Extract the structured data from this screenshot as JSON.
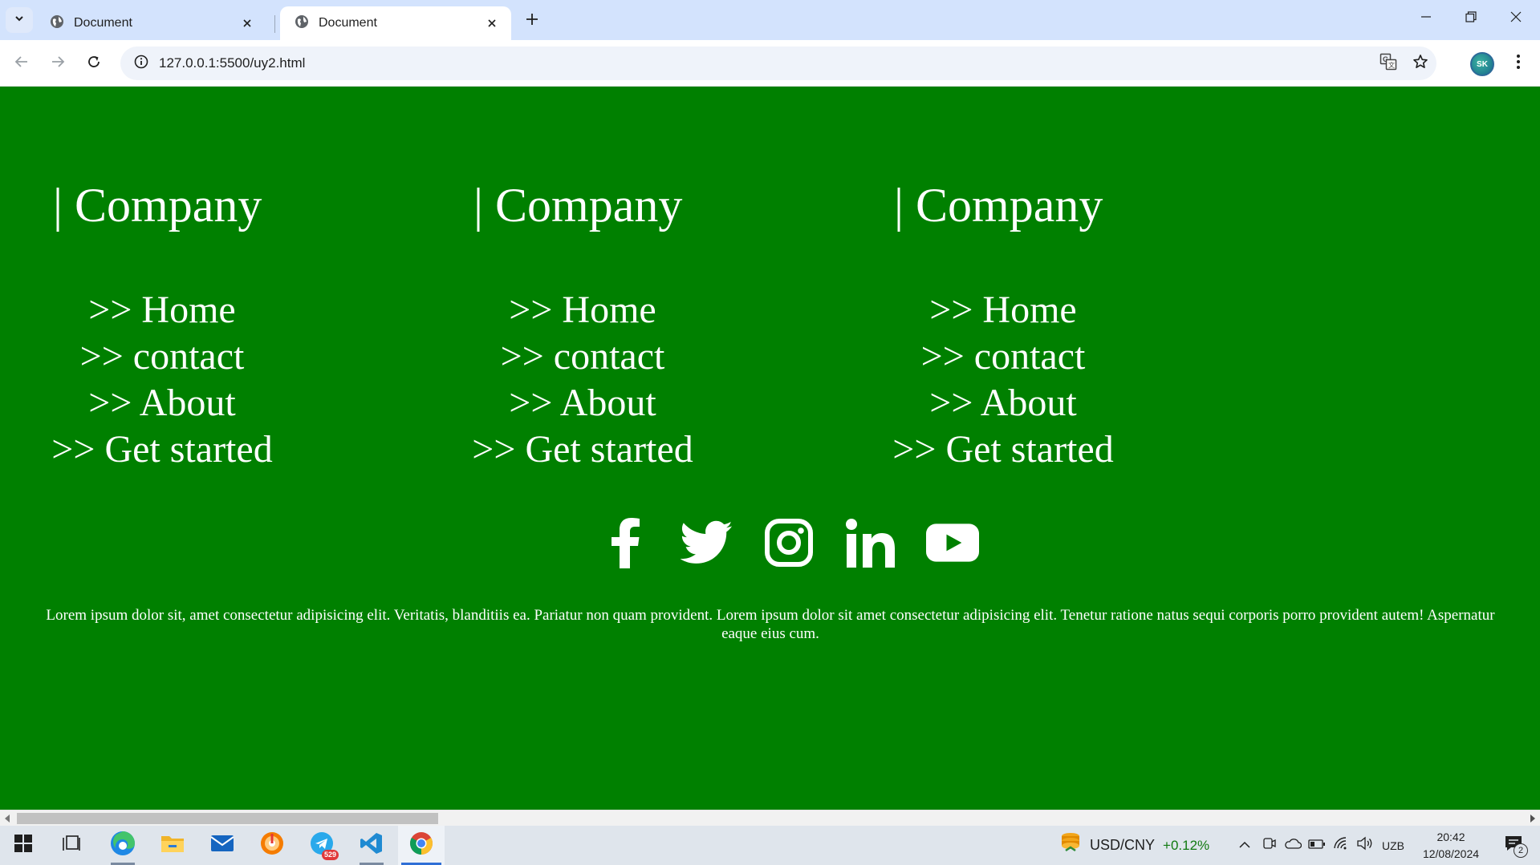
{
  "browser": {
    "tabs": [
      {
        "title": "Document",
        "active": false
      },
      {
        "title": "Document",
        "active": true
      }
    ],
    "url": "127.0.0.1:5500/uy2.html",
    "profile_initials": "SK"
  },
  "footer": {
    "columns": [
      {
        "heading": "| Company",
        "links": [
          ">> Home",
          ">> contact",
          ">> About",
          ">> Get started"
        ]
      },
      {
        "heading": "| Company",
        "links": [
          ">> Home",
          ">> contact",
          ">> About",
          ">> Get started"
        ]
      },
      {
        "heading": "| Company",
        "links": [
          ">> Home",
          ">> contact",
          ">> About",
          ">> Get started"
        ]
      }
    ],
    "socials": [
      "facebook-icon",
      "twitter-icon",
      "instagram-icon",
      "linkedin-icon",
      "youtube-icon"
    ],
    "text": "Lorem ipsum dolor sit, amet consectetur adipisicing elit. Veritatis, blanditiis ea. Pariatur non quam provident. Lorem ipsum dolor sit amet consectetur adipisicing elit. Tenetur ratione natus sequi corporis porro provident autem! Aspernatur eaque eius cum."
  },
  "colors": {
    "page_background": "#008000",
    "text": "#ffffff",
    "tabstrip": "#d3e3fd"
  },
  "taskbar": {
    "telegram_badge": "529",
    "ticker_symbol": "USD/CNY",
    "ticker_change": "+0.12%",
    "language": "UZB",
    "time": "20:42",
    "date": "12/08/2024",
    "notifications": "2"
  }
}
